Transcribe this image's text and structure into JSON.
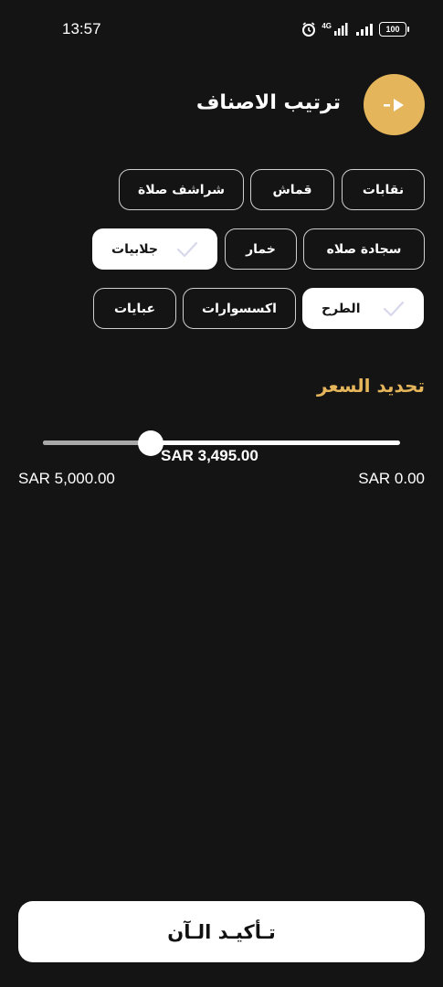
{
  "status_bar": {
    "time": "13:57",
    "network": "4G",
    "battery": "100"
  },
  "header": {
    "title": "ترتيب الاصناف"
  },
  "categories": [
    {
      "label": "نقابات",
      "selected": false
    },
    {
      "label": "قماش",
      "selected": false
    },
    {
      "label": "شراشف صلاة",
      "selected": false
    },
    {
      "label": "سجادة صلاه",
      "selected": false
    },
    {
      "label": "خمار",
      "selected": false
    },
    {
      "label": "جلابيات",
      "selected": true
    },
    {
      "label": "الطرح",
      "selected": true
    },
    {
      "label": "اكسسوارات",
      "selected": false
    },
    {
      "label": "عبايات",
      "selected": false
    }
  ],
  "price": {
    "section_title": "تحديد السعر",
    "current_value": "SAR 3,495.00",
    "min_label": "SAR 0.00",
    "max_label": "SAR 5,000.00",
    "slider_fraction": 0.301
  },
  "confirm_button": {
    "label": "تـأكيـد الـآن"
  },
  "colors": {
    "background": "#141414",
    "accent": "#e4b55a",
    "chip_border": "#cfcfcf",
    "selected_chip": "#ffffff"
  }
}
